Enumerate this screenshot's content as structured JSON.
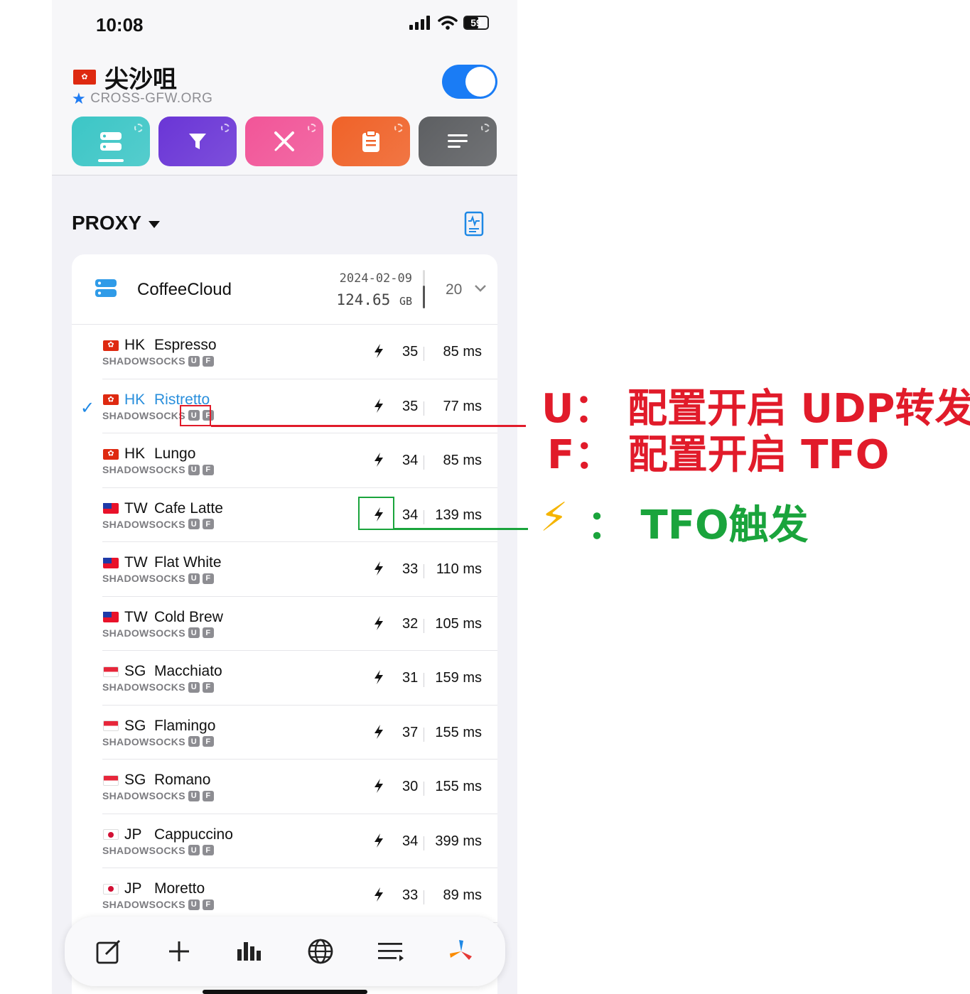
{
  "status_bar": {
    "time": "10:08",
    "battery": "59",
    "battery_level": 0.59
  },
  "header": {
    "location": "尖沙咀",
    "subtitle": "CROSS-GFW.ORG",
    "enabled": true
  },
  "tiles": [
    {
      "icon": "server-icon",
      "color": "#3cc6c6"
    },
    {
      "icon": "filter-icon",
      "color": "#6a35d6"
    },
    {
      "icon": "tools-icon",
      "color": "#f25598"
    },
    {
      "icon": "clipboard-icon",
      "color": "#f06228"
    },
    {
      "icon": "menu-lines-icon",
      "color": "#5d5f62"
    }
  ],
  "section": {
    "title": "PROXY"
  },
  "group": {
    "name": "CoffeeCloud",
    "date": "2024-02-09",
    "size": "124.65",
    "size_unit": "GB",
    "count": "20"
  },
  "nodes": [
    {
      "region": "HK",
      "name": "Espresso",
      "flag": "hk",
      "protocol": "SHADOWSOCKS",
      "u": "U",
      "f": "F",
      "hops": "35",
      "latency": "85 ms",
      "selected": false
    },
    {
      "region": "HK",
      "name": "Ristretto",
      "flag": "hk",
      "protocol": "SHADOWSOCKS",
      "u": "U",
      "f": "F",
      "hops": "35",
      "latency": "77 ms",
      "selected": true
    },
    {
      "region": "HK",
      "name": "Lungo",
      "flag": "hk",
      "protocol": "SHADOWSOCKS",
      "u": "U",
      "f": "F",
      "hops": "34",
      "latency": "85 ms",
      "selected": false
    },
    {
      "region": "TW",
      "name": "Cafe Latte",
      "flag": "tw",
      "protocol": "SHADOWSOCKS",
      "u": "U",
      "f": "F",
      "hops": "34",
      "latency": "139 ms",
      "selected": false
    },
    {
      "region": "TW",
      "name": "Flat White",
      "flag": "tw",
      "protocol": "SHADOWSOCKS",
      "u": "U",
      "f": "F",
      "hops": "33",
      "latency": "110 ms",
      "selected": false
    },
    {
      "region": "TW",
      "name": "Cold Brew",
      "flag": "tw",
      "protocol": "SHADOWSOCKS",
      "u": "U",
      "f": "F",
      "hops": "32",
      "latency": "105 ms",
      "selected": false
    },
    {
      "region": "SG",
      "name": "Macchiato",
      "flag": "sg",
      "protocol": "SHADOWSOCKS",
      "u": "U",
      "f": "F",
      "hops": "31",
      "latency": "159 ms",
      "selected": false
    },
    {
      "region": "SG",
      "name": "Flamingo",
      "flag": "sg",
      "protocol": "SHADOWSOCKS",
      "u": "U",
      "f": "F",
      "hops": "37",
      "latency": "155 ms",
      "selected": false
    },
    {
      "region": "SG",
      "name": "Romano",
      "flag": "sg",
      "protocol": "SHADOWSOCKS",
      "u": "U",
      "f": "F",
      "hops": "30",
      "latency": "155 ms",
      "selected": false
    },
    {
      "region": "JP",
      "name": "Cappuccino",
      "flag": "jp",
      "protocol": "SHADOWSOCKS",
      "u": "U",
      "f": "F",
      "hops": "34",
      "latency": "399 ms",
      "selected": false
    },
    {
      "region": "JP",
      "name": "Moretto",
      "flag": "jp",
      "protocol": "SHADOWSOCKS",
      "u": "U",
      "f": "F",
      "hops": "33",
      "latency": "89 ms",
      "selected": false
    }
  ],
  "dock": [
    "edit-icon",
    "plus-icon",
    "stats-icon",
    "globe-icon",
    "playlist-icon",
    "pinwheel-icon"
  ],
  "annotations": {
    "u_note": "U：  配置开启 UDP转发",
    "f_note": "F：  配置开启 TFO",
    "bolt_symbol": "⚡",
    "bolt_note": "：  TFO触发",
    "red": "#e11b2a",
    "green": "#1aa43c"
  }
}
